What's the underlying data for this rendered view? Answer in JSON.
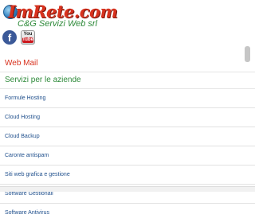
{
  "logo": {
    "main": "ImRete.com",
    "sub": "C&G Servizi Web srl"
  },
  "social": {
    "facebook_glyph": "f",
    "youtube_top": "You",
    "youtube_bottom": "Tube"
  },
  "menu": {
    "top_items": [
      {
        "label": "Web Mail",
        "color": "#d8321e"
      },
      {
        "label": "Servizi per le aziende",
        "color": "#2e8a3a"
      }
    ],
    "sub_items": [
      {
        "label": "Formule Hosting"
      },
      {
        "label": "Cloud Hosting"
      },
      {
        "label": "Cloud Backup"
      },
      {
        "label": "Caronte antispam"
      },
      {
        "label": "Siti web grafica e gestione"
      },
      {
        "label": "Software Gestionali"
      },
      {
        "label": "Software Antivirus"
      }
    ]
  }
}
